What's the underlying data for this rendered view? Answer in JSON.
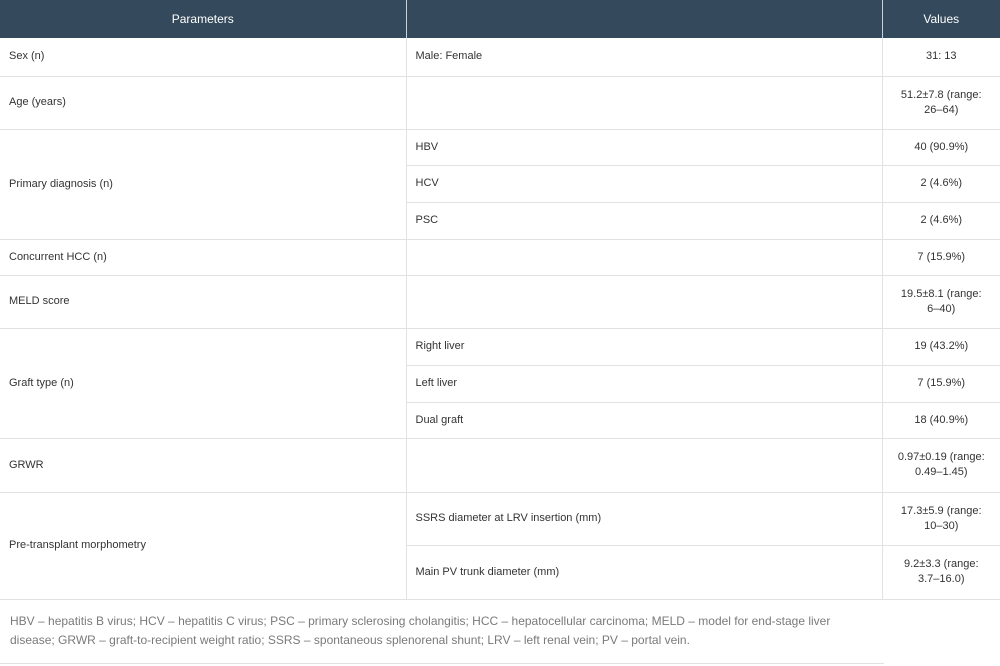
{
  "headers": {
    "parameters": "Parameters",
    "middle": "",
    "values": "Values"
  },
  "rows": {
    "sex": {
      "label": "Sex (n)",
      "sub": "Male: Female",
      "value": "31: 13"
    },
    "age": {
      "label": "Age (years)",
      "sub": "",
      "value": "51.2±7.8 (range: 26–64)"
    },
    "diagnosis": {
      "label": "Primary diagnosis (n)",
      "items": [
        {
          "sub": "HBV",
          "value": "40 (90.9%)"
        },
        {
          "sub": "HCV",
          "value": "2 (4.6%)"
        },
        {
          "sub": "PSC",
          "value": "2 (4.6%)"
        }
      ]
    },
    "hcc": {
      "label": "Concurrent HCC (n)",
      "sub": "",
      "value": "7 (15.9%)"
    },
    "meld": {
      "label": "MELD score",
      "sub": "",
      "value": "19.5±8.1 (range: 6–40)"
    },
    "graft": {
      "label": "Graft type (n)",
      "items": [
        {
          "sub": "Right liver",
          "value": "19 (43.2%)"
        },
        {
          "sub": "Left liver",
          "value": "7 (15.9%)"
        },
        {
          "sub": "Dual graft",
          "value": "18 (40.9%)"
        }
      ]
    },
    "grwr": {
      "label": "GRWR",
      "sub": "",
      "value": "0.97±0.19 (range: 0.49–1.45)"
    },
    "morphometry": {
      "label": "Pre-transplant morphometry",
      "items": [
        {
          "sub": "SSRS diameter at LRV insertion (mm)",
          "value": "17.3±5.9 (range: 10–30)"
        },
        {
          "sub": "Main PV trunk diameter (mm)",
          "value": "9.2±3.3 (range: 3.7–16.0)"
        }
      ]
    }
  },
  "footnote": "HBV – hepatitis B virus; HCV – hepatitis C virus; PSC – primary sclerosing cholangitis; HCC – hepatocellular carcinoma; MELD – model for end-stage liver disease; GRWR – graft-to-recipient weight ratio; SSRS – spontaneous splenorenal shunt; LRV – left renal vein; PV – portal vein."
}
